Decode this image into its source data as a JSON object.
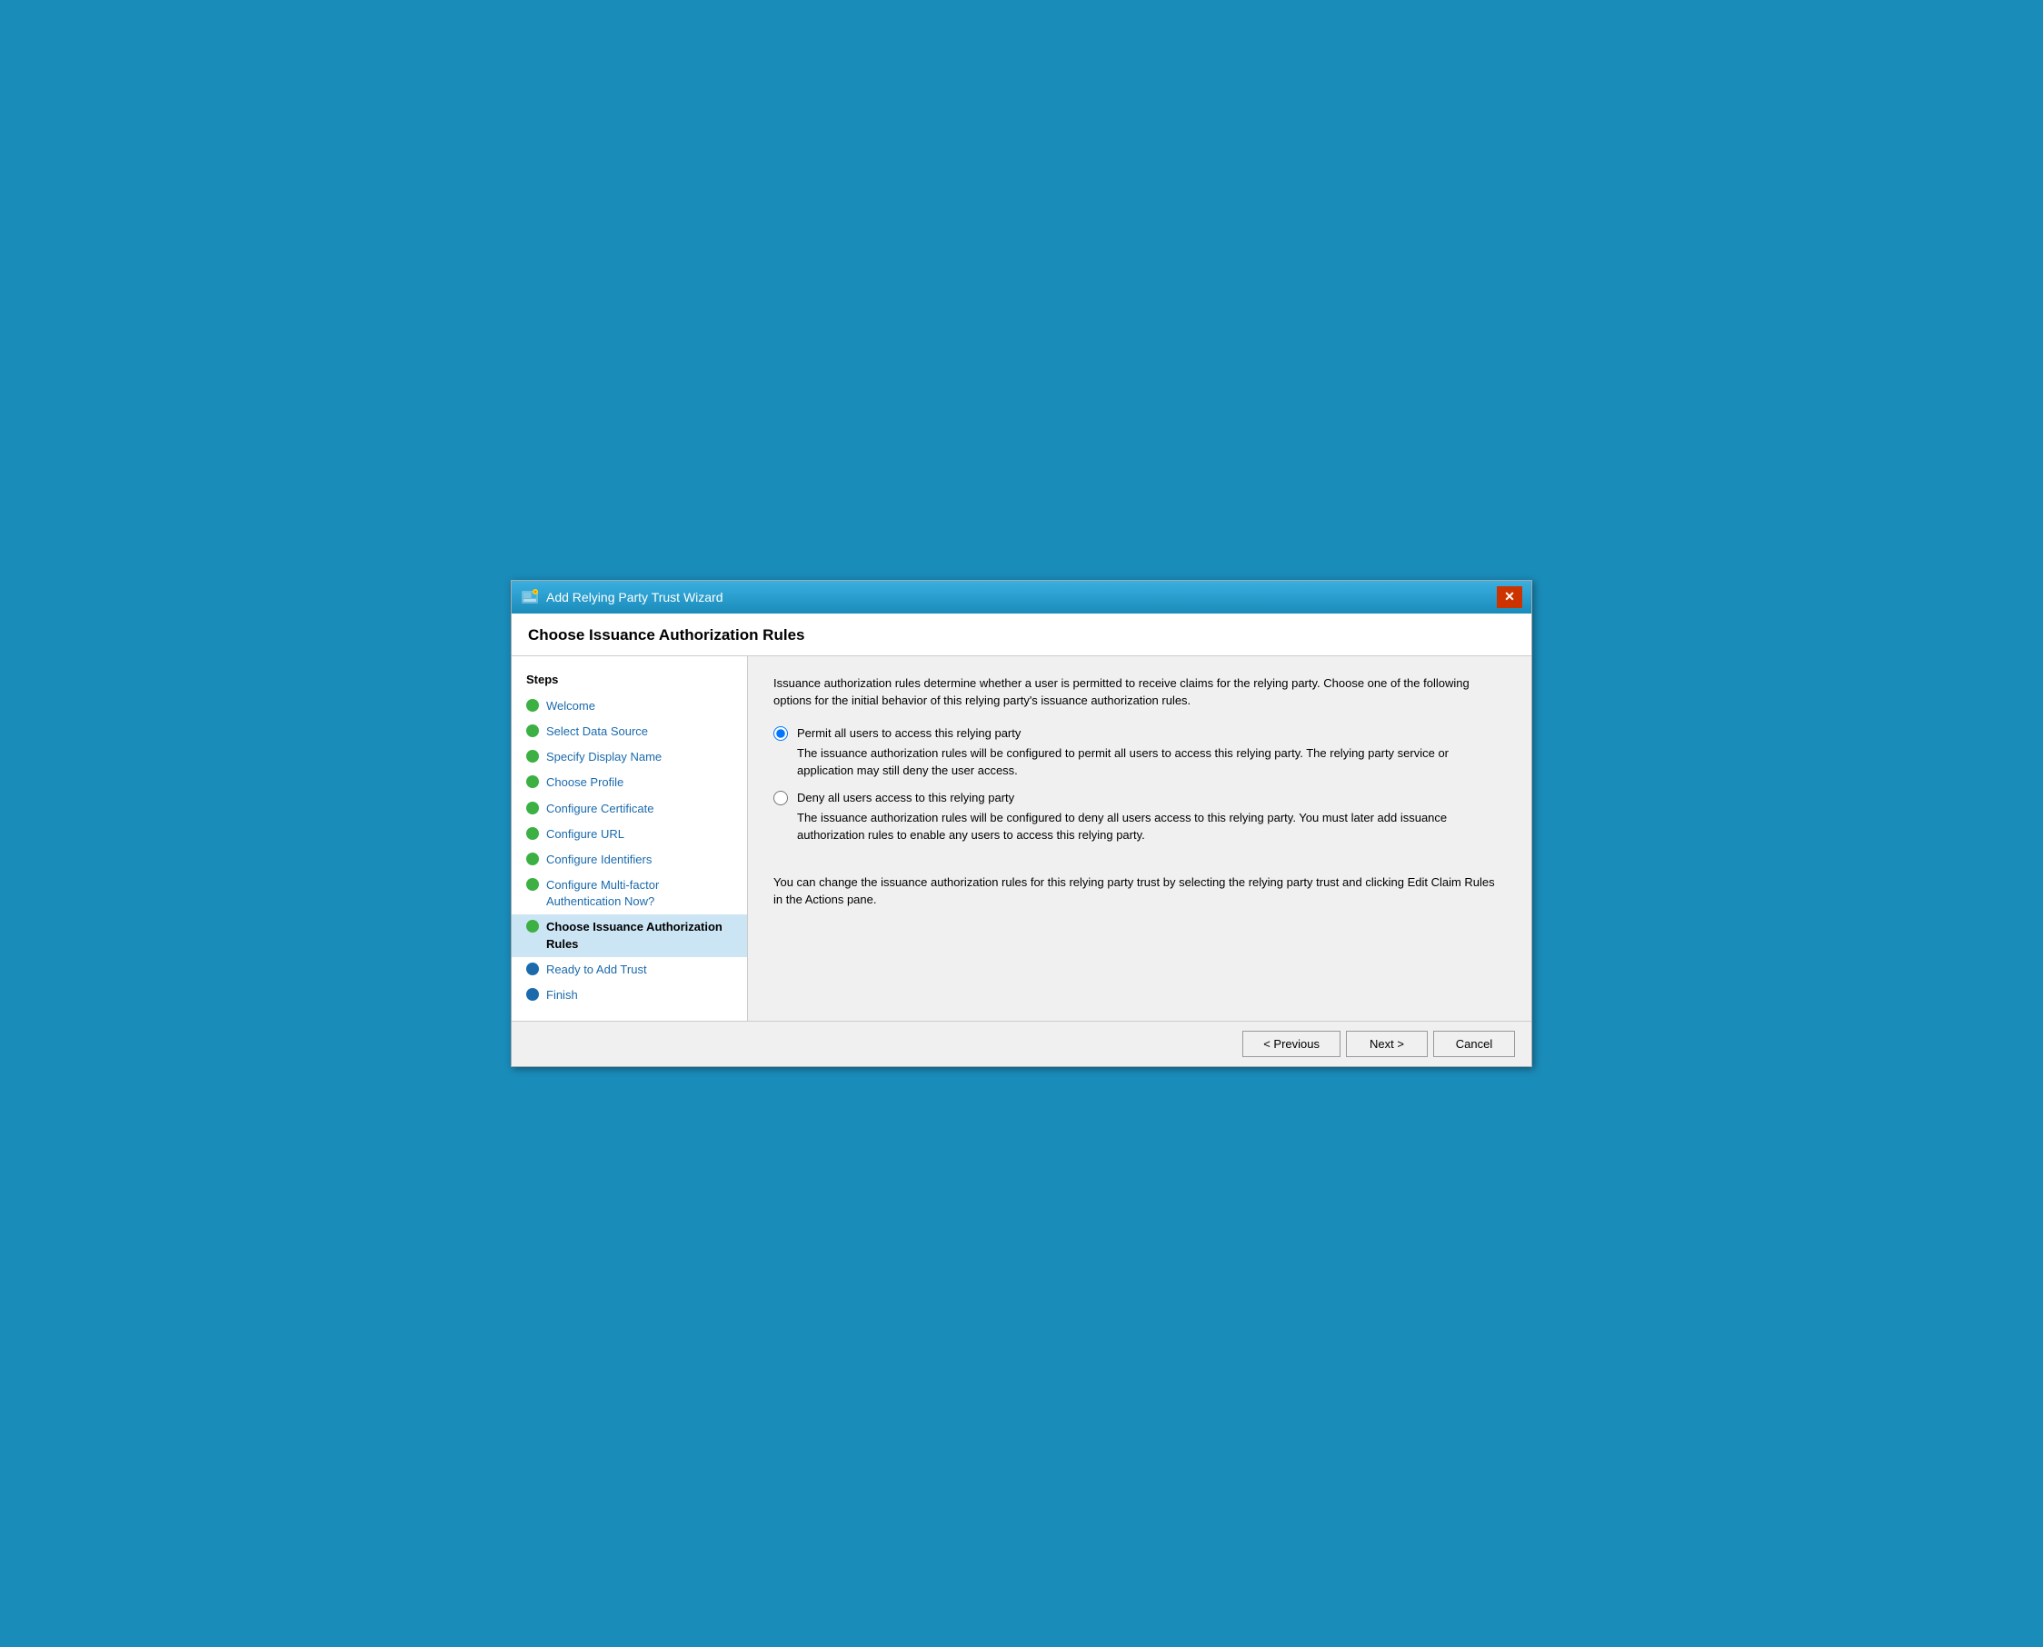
{
  "window": {
    "title": "Add Relying Party Trust Wizard",
    "close_label": "✕"
  },
  "page_header": {
    "title": "Choose Issuance Authorization Rules"
  },
  "sidebar": {
    "steps_label": "Steps",
    "items": [
      {
        "id": "welcome",
        "label": "Welcome",
        "dot": "green",
        "active": false
      },
      {
        "id": "select-data-source",
        "label": "Select Data Source",
        "dot": "green",
        "active": false
      },
      {
        "id": "specify-display-name",
        "label": "Specify Display Name",
        "dot": "green",
        "active": false
      },
      {
        "id": "choose-profile",
        "label": "Choose Profile",
        "dot": "green",
        "active": false
      },
      {
        "id": "configure-certificate",
        "label": "Configure Certificate",
        "dot": "green",
        "active": false
      },
      {
        "id": "configure-url",
        "label": "Configure URL",
        "dot": "green",
        "active": false
      },
      {
        "id": "configure-identifiers",
        "label": "Configure Identifiers",
        "dot": "green",
        "active": false
      },
      {
        "id": "configure-multifactor",
        "label": "Configure Multi-factor Authentication Now?",
        "dot": "green",
        "active": false
      },
      {
        "id": "choose-issuance",
        "label": "Choose Issuance Authorization Rules",
        "dot": "green",
        "active": true
      },
      {
        "id": "ready-to-add-trust",
        "label": "Ready to Add Trust",
        "dot": "blue",
        "active": false
      },
      {
        "id": "finish",
        "label": "Finish",
        "dot": "blue",
        "active": false
      }
    ]
  },
  "main": {
    "description": "Issuance authorization rules determine whether a user is permitted to receive claims for the relying party. Choose one of the following options for the initial behavior of this relying party's issuance authorization rules.",
    "options": [
      {
        "id": "permit-all",
        "label": "Permit all users to access this relying party",
        "description": "The issuance authorization rules will be configured to permit all users to access this relying party. The relying party service or application may still deny the user access.",
        "checked": true
      },
      {
        "id": "deny-all",
        "label": "Deny all users access to this relying party",
        "description": "The issuance authorization rules will be configured to deny all users access to this relying party. You must later add issuance authorization rules to enable any users to access this relying party.",
        "checked": false
      }
    ],
    "note": "You can change the issuance authorization rules for this relying party trust by selecting the relying party trust and clicking Edit Claim Rules in the Actions pane."
  },
  "footer": {
    "previous_label": "< Previous",
    "next_label": "Next >",
    "cancel_label": "Cancel"
  }
}
